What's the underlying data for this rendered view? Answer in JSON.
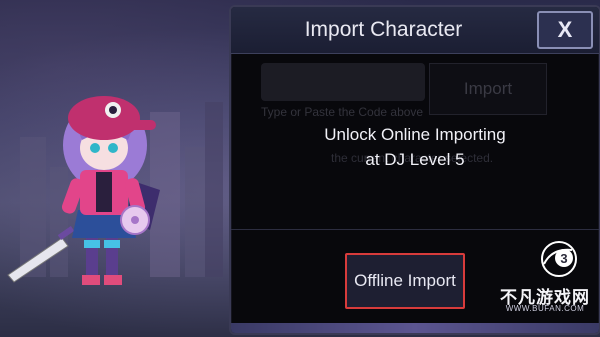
{
  "dialog": {
    "title": "Import Character",
    "close_label": "X",
    "code_input": {
      "value": "",
      "placeholder": ""
    },
    "import_label": "Import",
    "hint_text": "Type or Paste the Code above",
    "hint_sub": "the current character selected.",
    "unlock_line1": "Unlock Online Importing",
    "unlock_line2": "at DJ Level 5",
    "offline_import_label": "Offline Import"
  },
  "watermark": {
    "logo_text": "3",
    "site_name": "不凡游戏网",
    "url": "WWW.BUFAN.COM"
  },
  "colors": {
    "dialog_bg": "#08080c",
    "header_bg": "#1b1e33",
    "highlight_border": "#d83b3b",
    "character_hat": "#c0306e",
    "character_hair": "#9b7bd6"
  }
}
